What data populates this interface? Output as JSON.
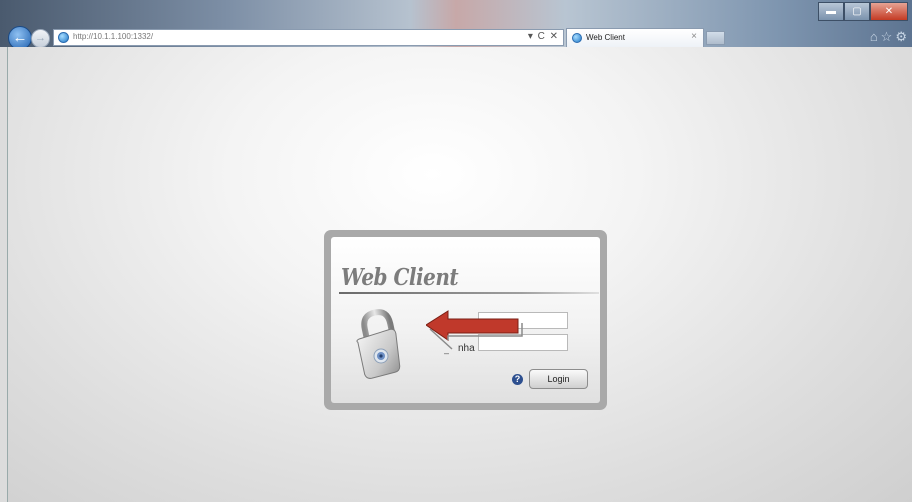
{
  "browser": {
    "address_url": "http://10.1.1.100:1332/",
    "address_controls": "▾ C ✕",
    "tab_title": "Web Client",
    "tab_close": "×",
    "window_min": "▬",
    "window_max": "▢",
    "window_close": "✕",
    "back_glyph": "←",
    "forward_glyph": "→",
    "right_icons": "⌂☆⚙"
  },
  "login": {
    "brand": "Web Client",
    "password_partial": "nha",
    "label_dash": "–",
    "help_glyph": "?",
    "login_button": "Login"
  },
  "icons": [
    "padlock-icon",
    "help-icon",
    "red-arrow-annotation",
    "ie-favicon"
  ],
  "colors": {
    "arrow_red": "#c0392b",
    "panel_border": "#a9a9a9",
    "help_blue": "#2d4f8f"
  }
}
